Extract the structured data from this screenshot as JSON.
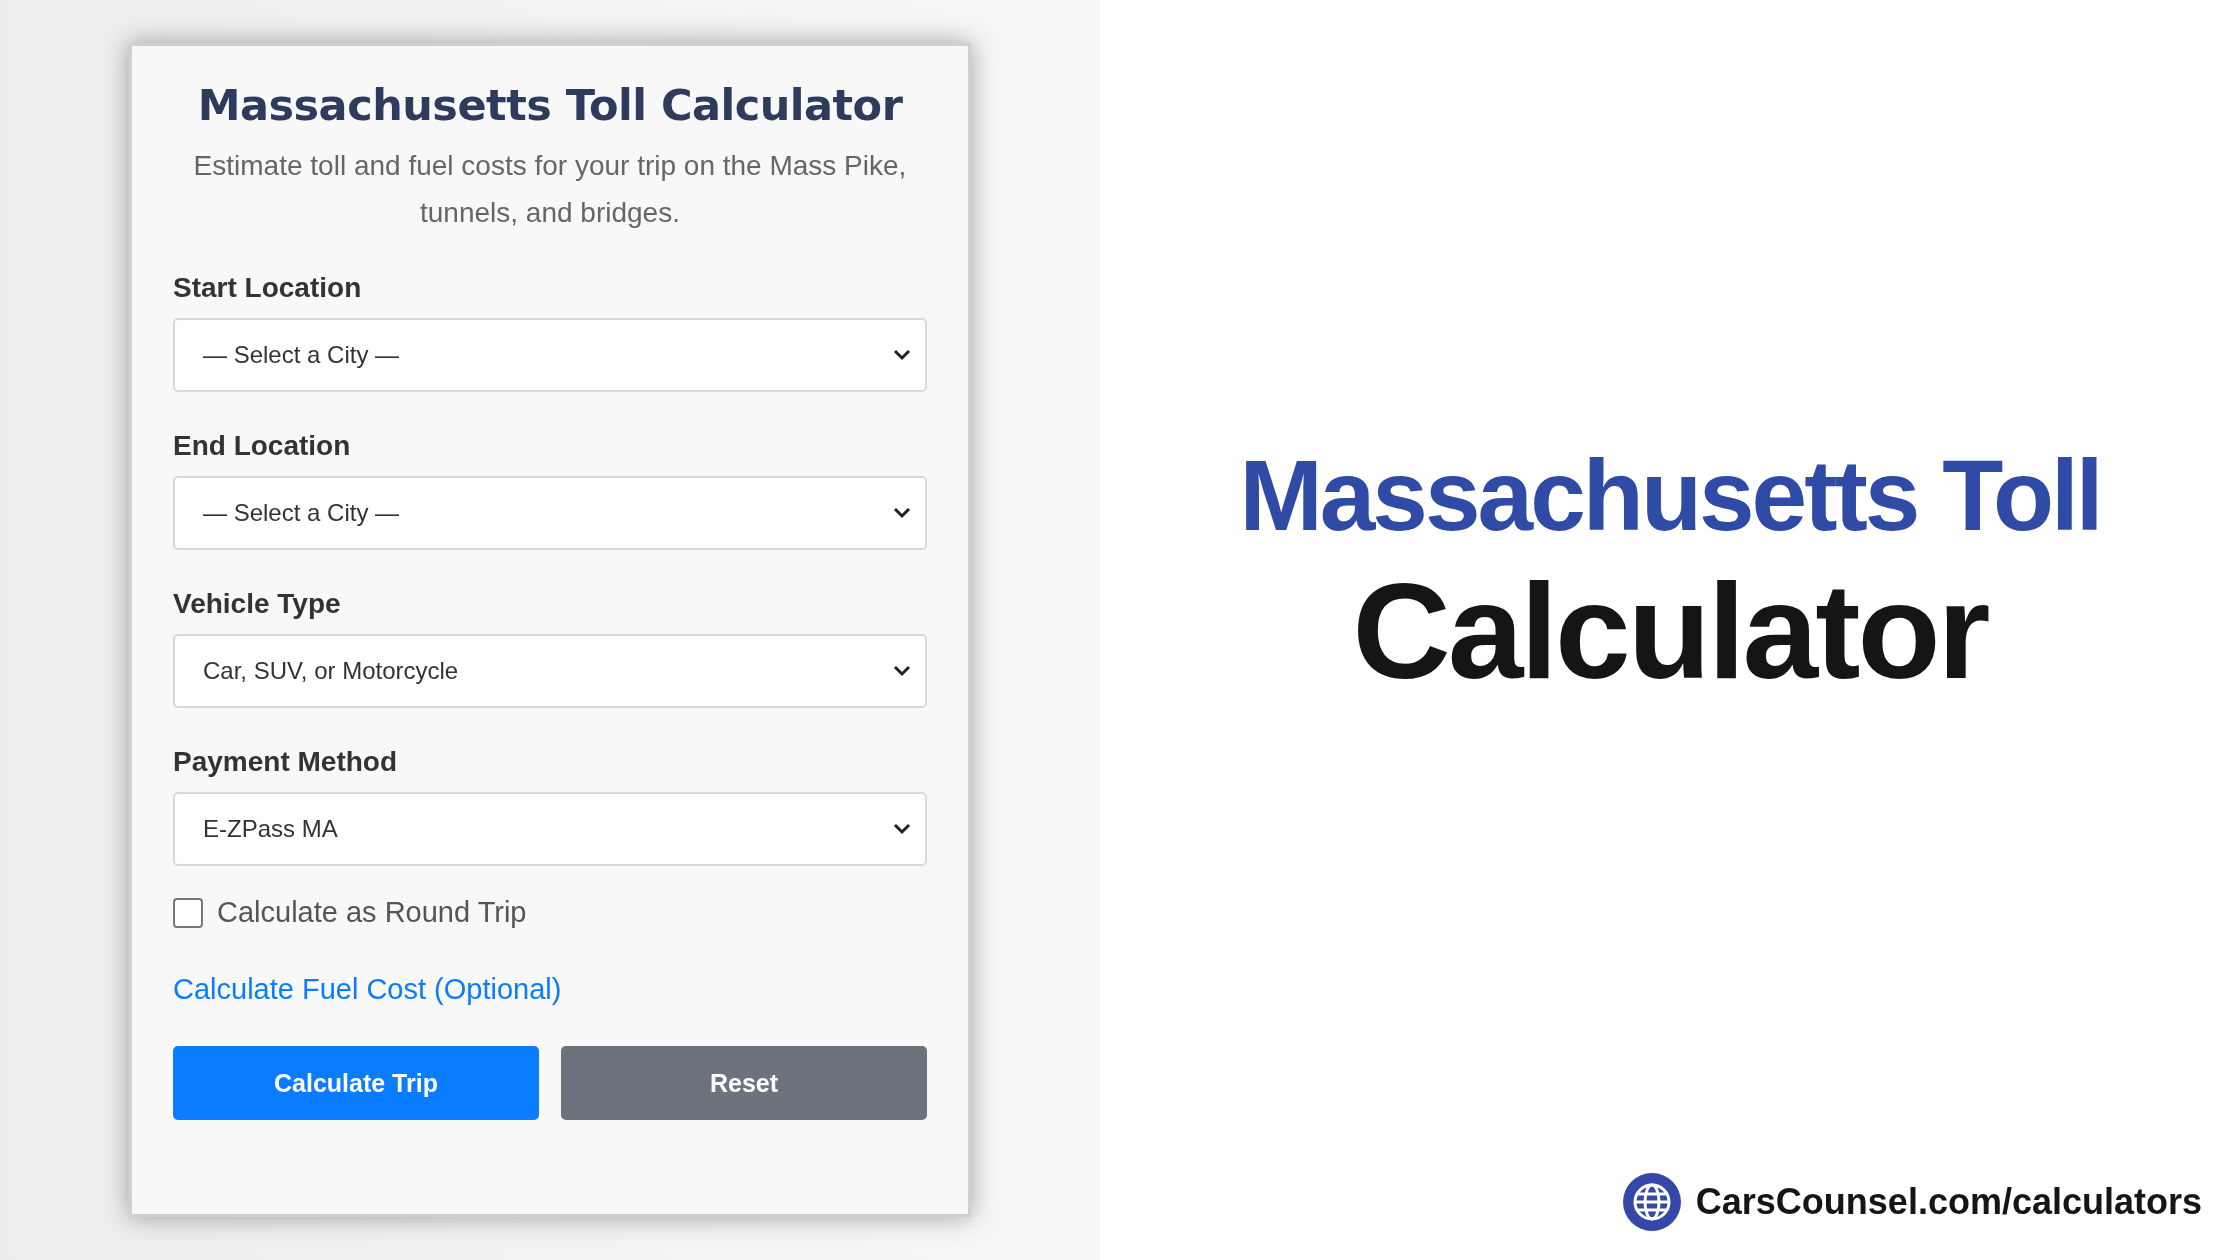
{
  "form": {
    "title": "Massachusetts Toll Calculator",
    "subtitle": "Estimate toll and fuel costs for your trip on the Mass Pike, tunnels, and bridges.",
    "fields": [
      {
        "label": "Start Location",
        "value": "— Select a City —"
      },
      {
        "label": "End Location",
        "value": "— Select a City —"
      },
      {
        "label": "Vehicle Type",
        "value": "Car, SUV, or Motorcycle"
      },
      {
        "label": "Payment Method",
        "value": "E-ZPass MA"
      }
    ],
    "round_trip": {
      "label": "Calculate as Round Trip",
      "checked": false
    },
    "fuel_link": "Calculate Fuel Cost (Optional)",
    "buttons": [
      {
        "label": "Calculate Trip",
        "kind": "primary"
      },
      {
        "label": "Reset",
        "kind": "secondary"
      }
    ]
  },
  "headline": {
    "line_1": "Massachusetts Toll",
    "line_2": "Calculator"
  },
  "footer": {
    "url": "CarsCounsel.com/calculators"
  }
}
